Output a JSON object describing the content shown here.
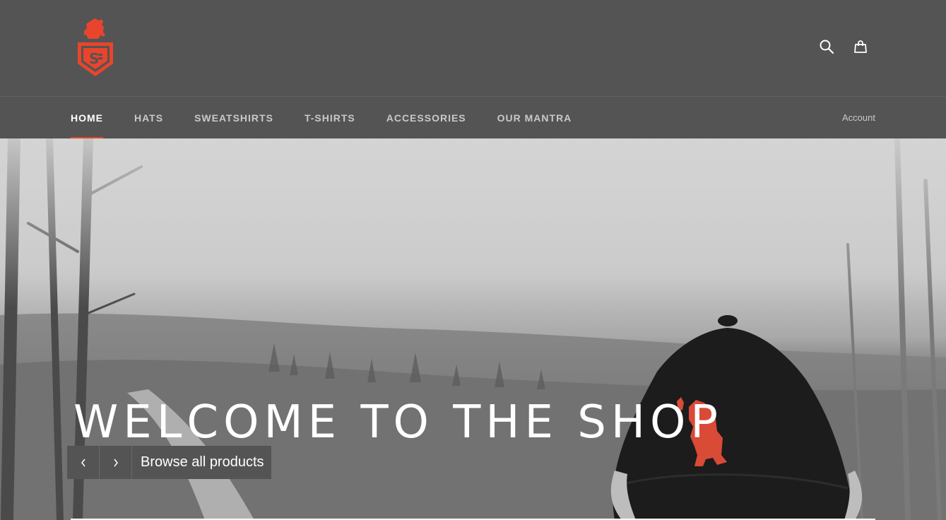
{
  "header": {
    "logo_name": "bear-shield-logo",
    "brand_color": "#e8452c",
    "icons": [
      "search-icon",
      "cart-icon"
    ]
  },
  "nav": {
    "items": [
      {
        "label": "HOME",
        "active": true
      },
      {
        "label": "HATS",
        "active": false
      },
      {
        "label": "SWEATSHIRTS",
        "active": false
      },
      {
        "label": "T-SHIRTS",
        "active": false
      },
      {
        "label": "ACCESSORIES",
        "active": false
      },
      {
        "label": "OUR MANTRA",
        "active": false
      }
    ],
    "account_label": "Account",
    "active_underline_color": "#e8452c"
  },
  "hero": {
    "title": "WELCOME TO THE SHOP",
    "cta_label": "Browse all products",
    "controls": [
      "chevron-left-icon",
      "chevron-right-icon"
    ]
  }
}
